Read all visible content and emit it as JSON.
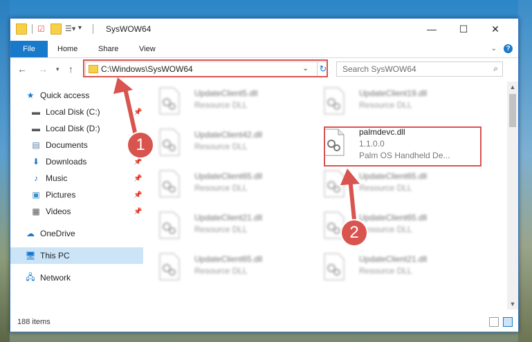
{
  "window": {
    "title": "SysWOW64",
    "min_label": "—",
    "max_label": "☐",
    "close_label": "✕"
  },
  "ribbon": {
    "tabs": [
      "File",
      "Home",
      "Share",
      "View"
    ]
  },
  "nav": {
    "address": "C:\\Windows\\SysWOW64",
    "search_placeholder": "Search SysWOW64"
  },
  "sidebar": {
    "items": [
      {
        "label": "Quick access",
        "icon": "star-icon"
      },
      {
        "label": "Local Disk (C:)",
        "icon": "drive-icon"
      },
      {
        "label": "Local Disk (D:)",
        "icon": "drive-icon"
      },
      {
        "label": "Documents",
        "icon": "documents-icon"
      },
      {
        "label": "Downloads",
        "icon": "download-icon"
      },
      {
        "label": "Music",
        "icon": "music-icon"
      },
      {
        "label": "Pictures",
        "icon": "pictures-icon"
      },
      {
        "label": "Videos",
        "icon": "videos-icon"
      },
      {
        "label": "OneDrive",
        "icon": "cloud-icon"
      },
      {
        "label": "This PC",
        "icon": "computer-icon"
      },
      {
        "label": "Network",
        "icon": "network-icon"
      }
    ]
  },
  "files": [
    {
      "name": "UpdateClient5.dll",
      "type": "Resource DLL"
    },
    {
      "name": "UpdateClient19.dll",
      "type": "Resource DLL"
    },
    {
      "name": "UpdateClient42.dll",
      "type": "Resource DLL"
    },
    {
      "name": "palmdevc.dll",
      "version": "1.1.0.0",
      "description": "Palm OS Handheld De..."
    },
    {
      "name": "UpdateClient65.dll",
      "type": "Resource DLL"
    },
    {
      "name": "UpdateClient65.dll",
      "type": "Resource DLL"
    },
    {
      "name": "UpdateClient21.dll",
      "type": "Resource DLL"
    },
    {
      "name": "UpdateClient65.dll",
      "type": "Resource DLL"
    },
    {
      "name": "UpdateClient65.dll",
      "type": "Resource DLL"
    },
    {
      "name": "UpdateClient21.dll",
      "type": "Resource DLL"
    }
  ],
  "status": {
    "item_count": "188 items"
  },
  "annotations": {
    "step1": "1",
    "step2": "2",
    "highlight_color": "#d9534f"
  },
  "colors": {
    "accent": "#1979ca",
    "selected": "#cce4f7"
  }
}
